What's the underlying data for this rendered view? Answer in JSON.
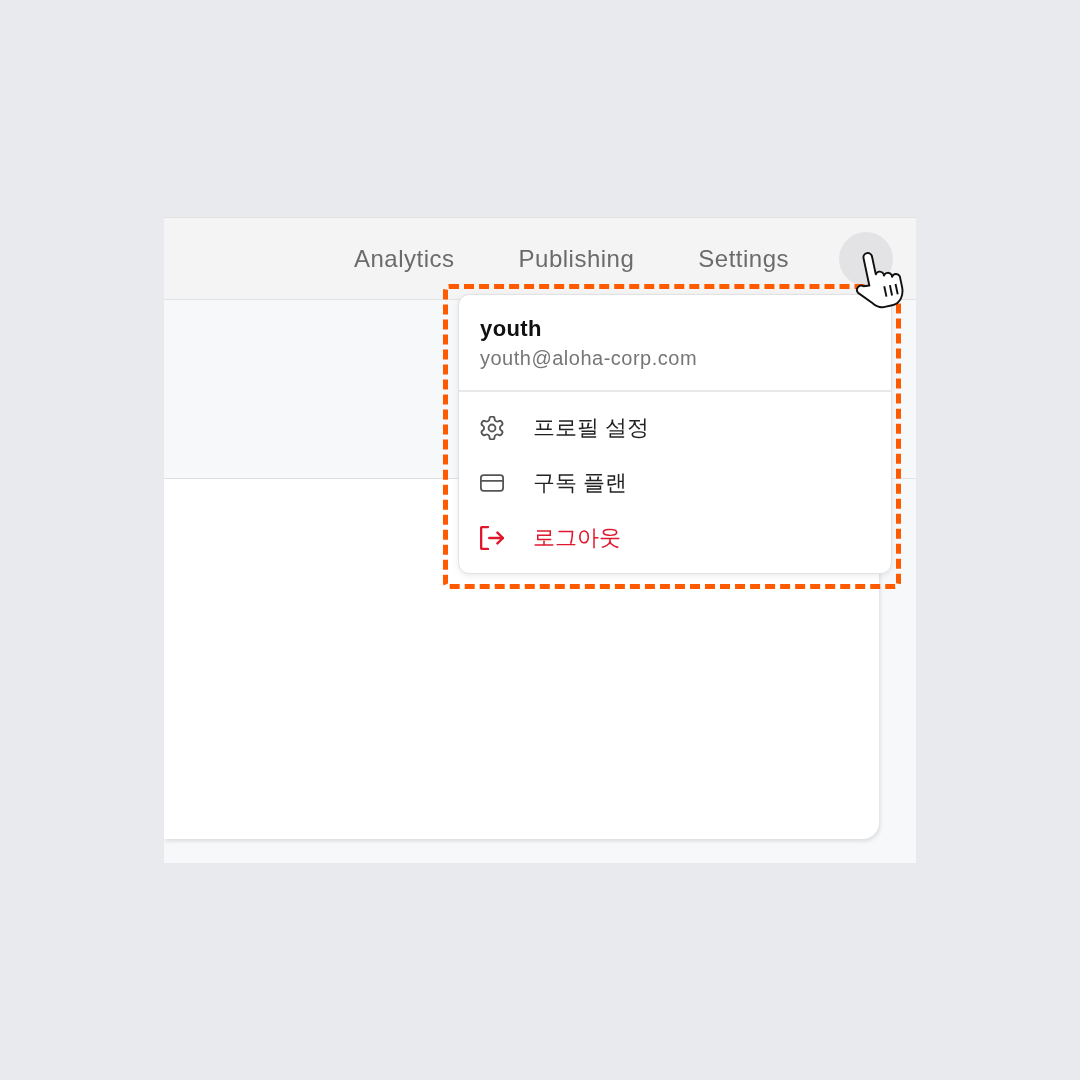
{
  "nav": {
    "links": [
      {
        "label": "Analytics"
      },
      {
        "label": "Publishing"
      },
      {
        "label": "Settings"
      }
    ]
  },
  "user_menu": {
    "open": true,
    "highlighted": true,
    "name": "youth",
    "email": "youth@aloha-corp.com",
    "items": [
      {
        "kind": "profile",
        "label": "프로필 설정",
        "danger": false
      },
      {
        "kind": "subscription",
        "label": "구독 플랜",
        "danger": false
      },
      {
        "kind": "logout",
        "label": "로그아웃",
        "danger": true
      }
    ]
  }
}
